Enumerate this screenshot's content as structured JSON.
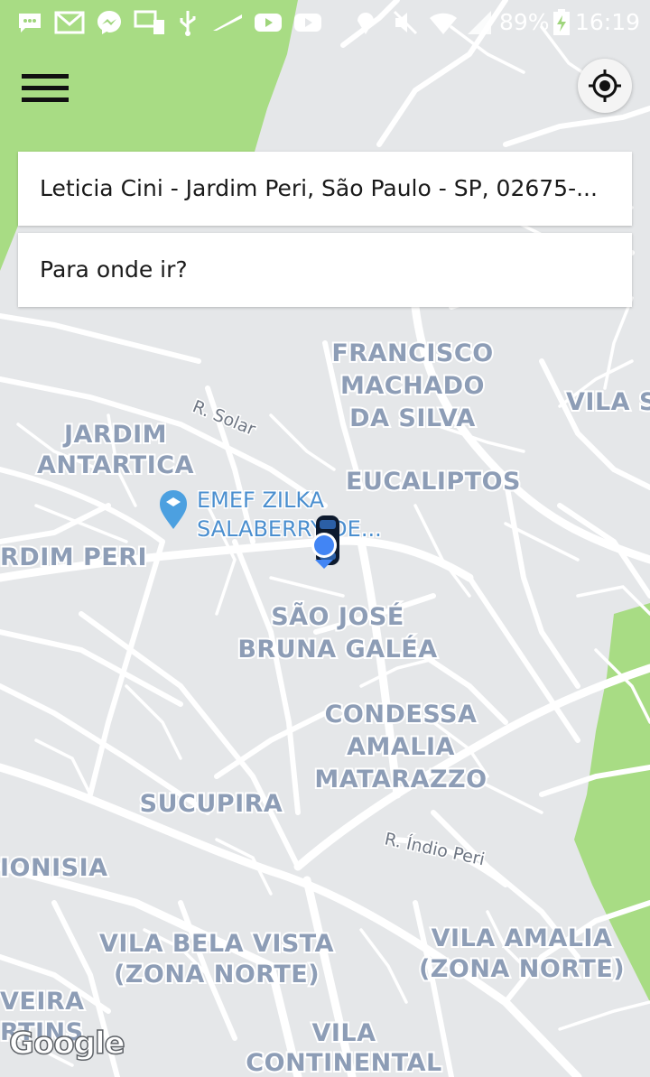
{
  "status_bar": {
    "battery_percent": "89%",
    "time": "16:19",
    "icons": [
      "chat-icon",
      "gmail-icon",
      "messenger-icon",
      "sim-toolkit-icon",
      "usb-icon",
      "tv-icon",
      "youtube-icon",
      "youtube-icon",
      "location-icon",
      "mute-icon",
      "wifi-icon",
      "signal-icon",
      "battery-charging-icon"
    ]
  },
  "map": {
    "neighborhoods": [
      {
        "text": [
          "FRANCISCO",
          "MACHADO",
          "DA SILVA"
        ]
      },
      {
        "text": [
          "VILA SA"
        ]
      },
      {
        "text": [
          "JARDIM",
          "ANTARTICA"
        ]
      },
      {
        "text": [
          "EUCALIPTOS"
        ]
      },
      {
        "text": [
          "RDIM PERI"
        ]
      },
      {
        "text": [
          "SÃO JOSÉ",
          "BRUNA GALÉA"
        ]
      },
      {
        "text": [
          "CONDESSA",
          "AMALIA",
          "MATARAZZO"
        ]
      },
      {
        "text": [
          "SUCUPIRA"
        ]
      },
      {
        "text": [
          "IONISIA"
        ]
      },
      {
        "text": [
          "VILA BELA VISTA",
          "(ZONA NORTE)"
        ]
      },
      {
        "text": [
          "VILA AMALIA",
          "(ZONA NORTE)"
        ]
      },
      {
        "text": [
          "VEIRA",
          "RTINS"
        ]
      },
      {
        "text": [
          "VILA",
          "CONTINENTAL"
        ]
      }
    ],
    "streets": [
      "R. Solar",
      "R. Índio Peri"
    ],
    "poi": {
      "line1": "EMEF ZILKA",
      "line2": "SALABERRY DE..."
    },
    "attribution": "Google",
    "colors": {
      "land": "#e5e7e9",
      "road": "#ffffff",
      "park": "#a8dc84",
      "label": "#8d9db6",
      "user_dot": "#4285f4"
    }
  },
  "controls": {
    "menu_icon": "hamburger-menu-icon",
    "locate_icon": "gps-locate-icon"
  },
  "search": {
    "origin": "Leticia Cini - Jardim Peri, São Paulo - SP, 02675-...",
    "destination_placeholder": "Para onde ir?"
  }
}
